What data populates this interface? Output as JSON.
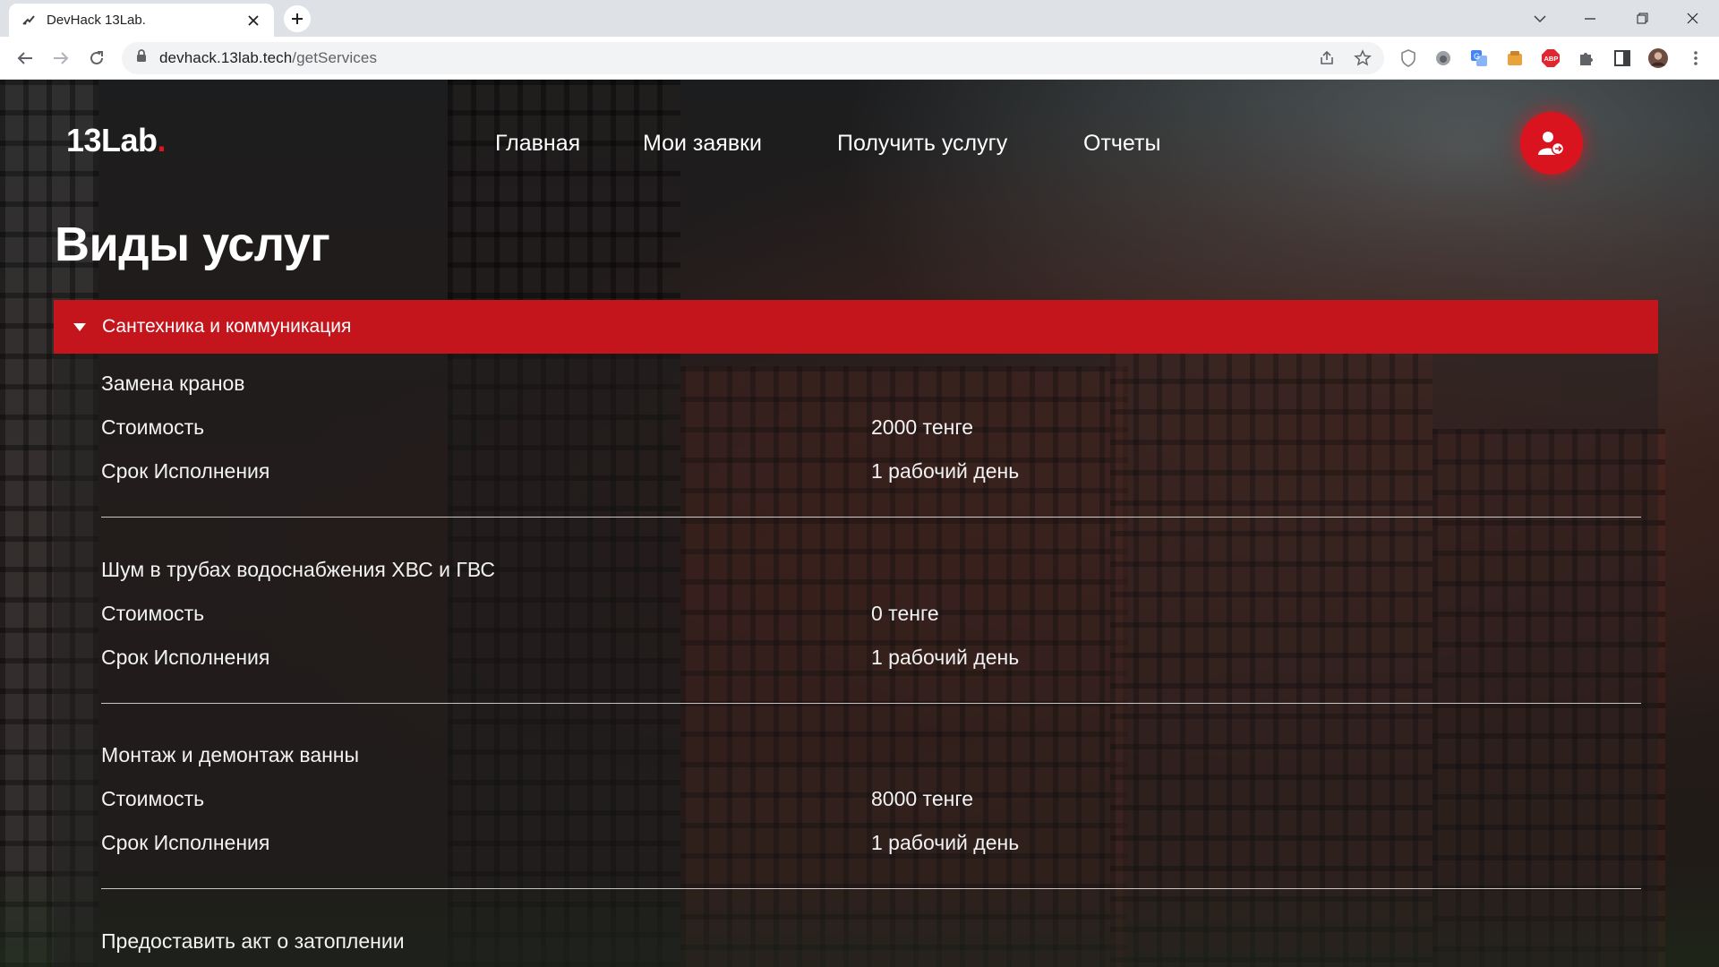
{
  "browser": {
    "tab_title": "DevHack 13Lab.",
    "url_host": "devhack.13lab.tech",
    "url_path": "/getServices"
  },
  "site": {
    "logo_text": "13Lab",
    "logo_dot": ".",
    "nav": [
      "Главная",
      "Мои заявки",
      "Получить услугу",
      "Отчеты"
    ],
    "accent_color": "#d9141f"
  },
  "page_title": "Виды услуг",
  "category": {
    "title": "Сантехника и коммуникация",
    "services": [
      {
        "name": "Замена кранов",
        "cost_label": "Стоимость",
        "cost": "2000 тенге",
        "term_label": "Срок Исполнения",
        "term": "1 рабочий день"
      },
      {
        "name": "Шум в трубах водоснабжения ХВС и ГВС",
        "cost_label": "Стоимость",
        "cost": "0 тенге",
        "term_label": "Срок Исполнения",
        "term": "1 рабочий день"
      },
      {
        "name": "Монтаж и демонтаж ванны",
        "cost_label": "Стоимость",
        "cost": "8000 тенге",
        "term_label": "Срок Исполнения",
        "term": "1 рабочий день"
      },
      {
        "name": "Предоставить акт о затоплении"
      }
    ]
  }
}
